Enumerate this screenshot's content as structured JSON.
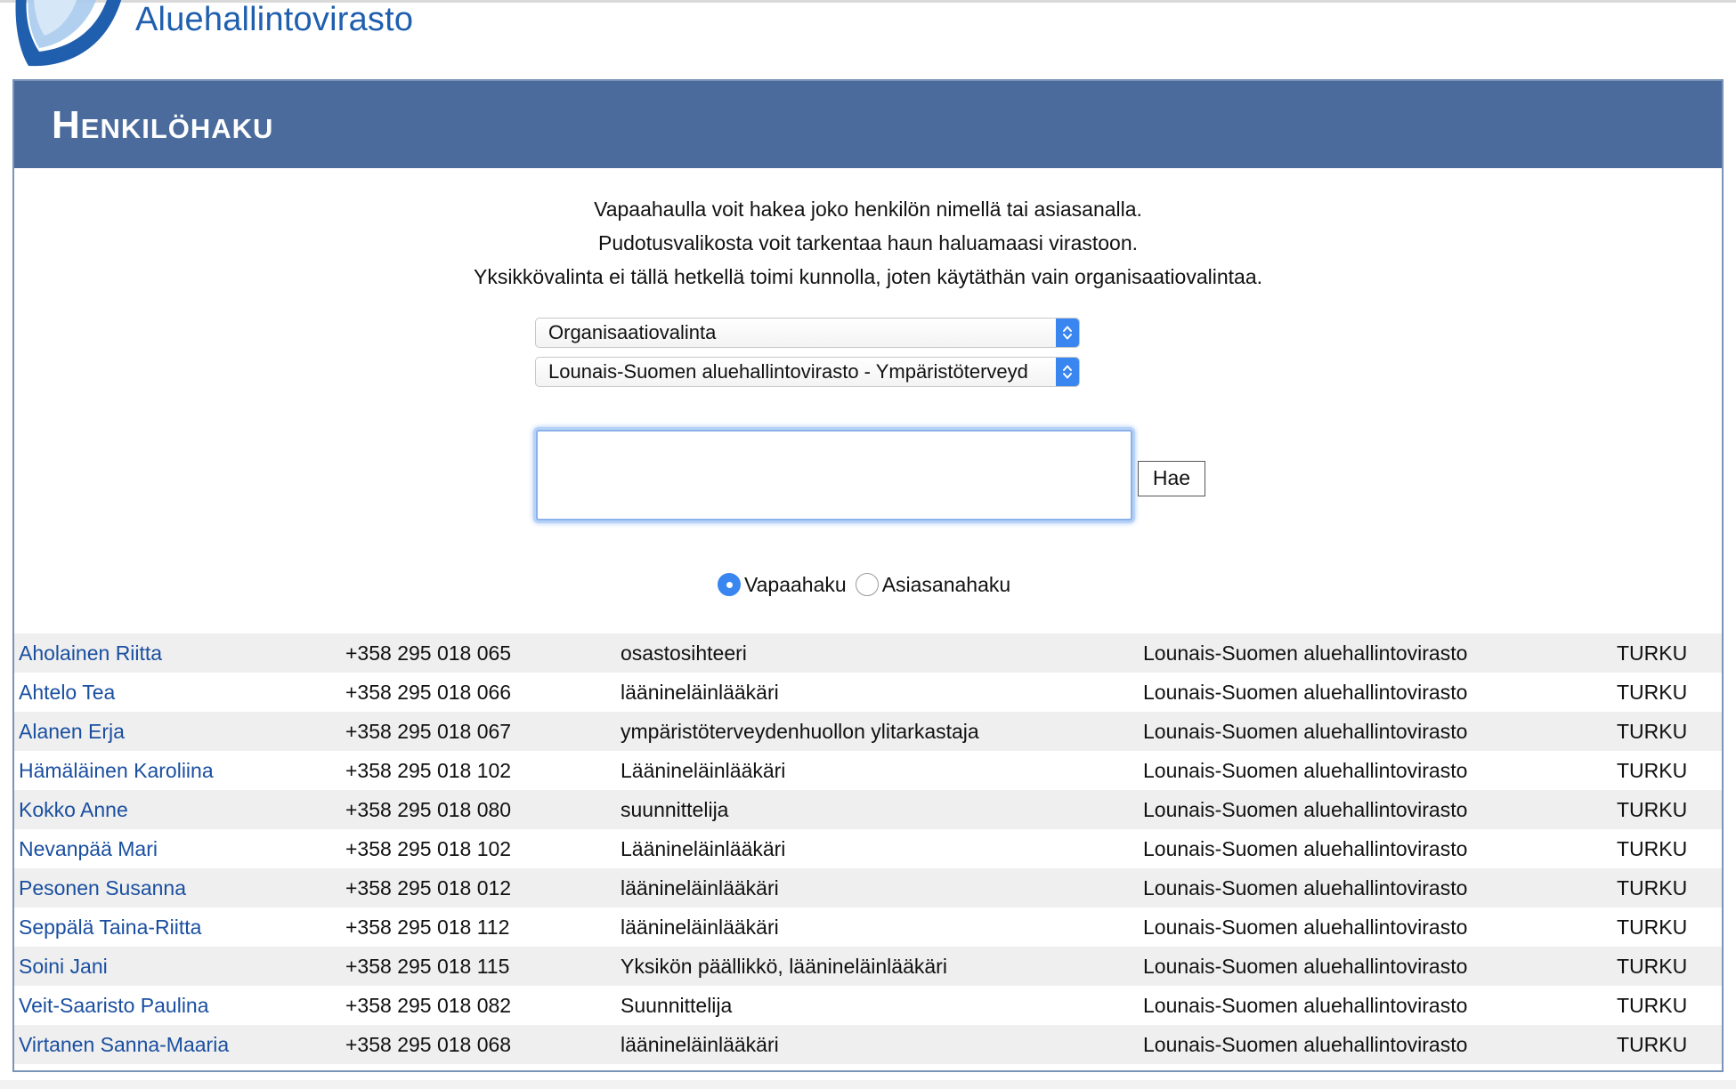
{
  "header": {
    "logo_text": "Aluehallintovirasto"
  },
  "panel": {
    "title": "Henkilöhaku",
    "intro_lines": [
      "Vapaahaulla voit hakea joko henkilön nimellä tai asiasanalla.",
      "Pudotusvalikosta voit tarkentaa haun haluamaasi virastoon.",
      "Yksikkövalinta ei tällä hetkellä toimi kunnolla, joten käytäthän vain organisaatiovalintaa."
    ]
  },
  "filters": {
    "organization_select": "Organisaatiovalinta",
    "unit_select": "Lounais-Suomen aluehallintovirasto - Ympäristöterveyd"
  },
  "search": {
    "input_value": "",
    "button_label": "Hae"
  },
  "search_mode": {
    "options": [
      "Vapaahaku",
      "Asiasanahaku"
    ],
    "selected": "Vapaahaku"
  },
  "colors": {
    "title_bar": "#4a6b9b",
    "name_link": "#1a4fa0",
    "logo": "#1f5fae",
    "select_arrow": "#3a86f0"
  },
  "results": [
    {
      "name": "Aholainen Riitta",
      "phone": "+358 295 018 065",
      "title": "osastosihteeri",
      "organization": "Lounais-Suomen aluehallintovirasto",
      "city": "TURKU"
    },
    {
      "name": "Ahtelo Tea",
      "phone": "+358 295 018 066",
      "title": "läänineläinlääkäri",
      "organization": "Lounais-Suomen aluehallintovirasto",
      "city": "TURKU"
    },
    {
      "name": "Alanen Erja",
      "phone": "+358 295 018 067",
      "title": "ympäristöterveydenhuollon ylitarkastaja",
      "organization": "Lounais-Suomen aluehallintovirasto",
      "city": "TURKU"
    },
    {
      "name": "Hämäläinen Karoliina",
      "phone": "+358 295 018 102",
      "title": "Läänineläinlääkäri",
      "organization": "Lounais-Suomen aluehallintovirasto",
      "city": "TURKU"
    },
    {
      "name": "Kokko Anne",
      "phone": "+358 295 018 080",
      "title": "suunnittelija",
      "organization": "Lounais-Suomen aluehallintovirasto",
      "city": "TURKU"
    },
    {
      "name": "Nevanpää Mari",
      "phone": "+358 295 018 102",
      "title": "Läänineläinlääkäri",
      "organization": "Lounais-Suomen aluehallintovirasto",
      "city": "TURKU"
    },
    {
      "name": "Pesonen Susanna",
      "phone": "+358 295 018 012",
      "title": "läänineläinlääkäri",
      "organization": "Lounais-Suomen aluehallintovirasto",
      "city": "TURKU"
    },
    {
      "name": "Seppälä Taina-Riitta",
      "phone": "+358 295 018 112",
      "title": "läänineläinlääkäri",
      "organization": "Lounais-Suomen aluehallintovirasto",
      "city": "TURKU"
    },
    {
      "name": "Soini Jani",
      "phone": "+358 295 018 115",
      "title": "Yksikön päällikkö, läänineläinlääkäri",
      "organization": "Lounais-Suomen aluehallintovirasto",
      "city": "TURKU"
    },
    {
      "name": "Veit-Saaristo Paulina",
      "phone": "+358 295 018 082",
      "title": "Suunnittelija",
      "organization": "Lounais-Suomen aluehallintovirasto",
      "city": "TURKU"
    },
    {
      "name": "Virtanen Sanna-Maaria",
      "phone": "+358 295 018 068",
      "title": "läänineläinlääkäri",
      "organization": "Lounais-Suomen aluehallintovirasto",
      "city": "TURKU"
    }
  ]
}
